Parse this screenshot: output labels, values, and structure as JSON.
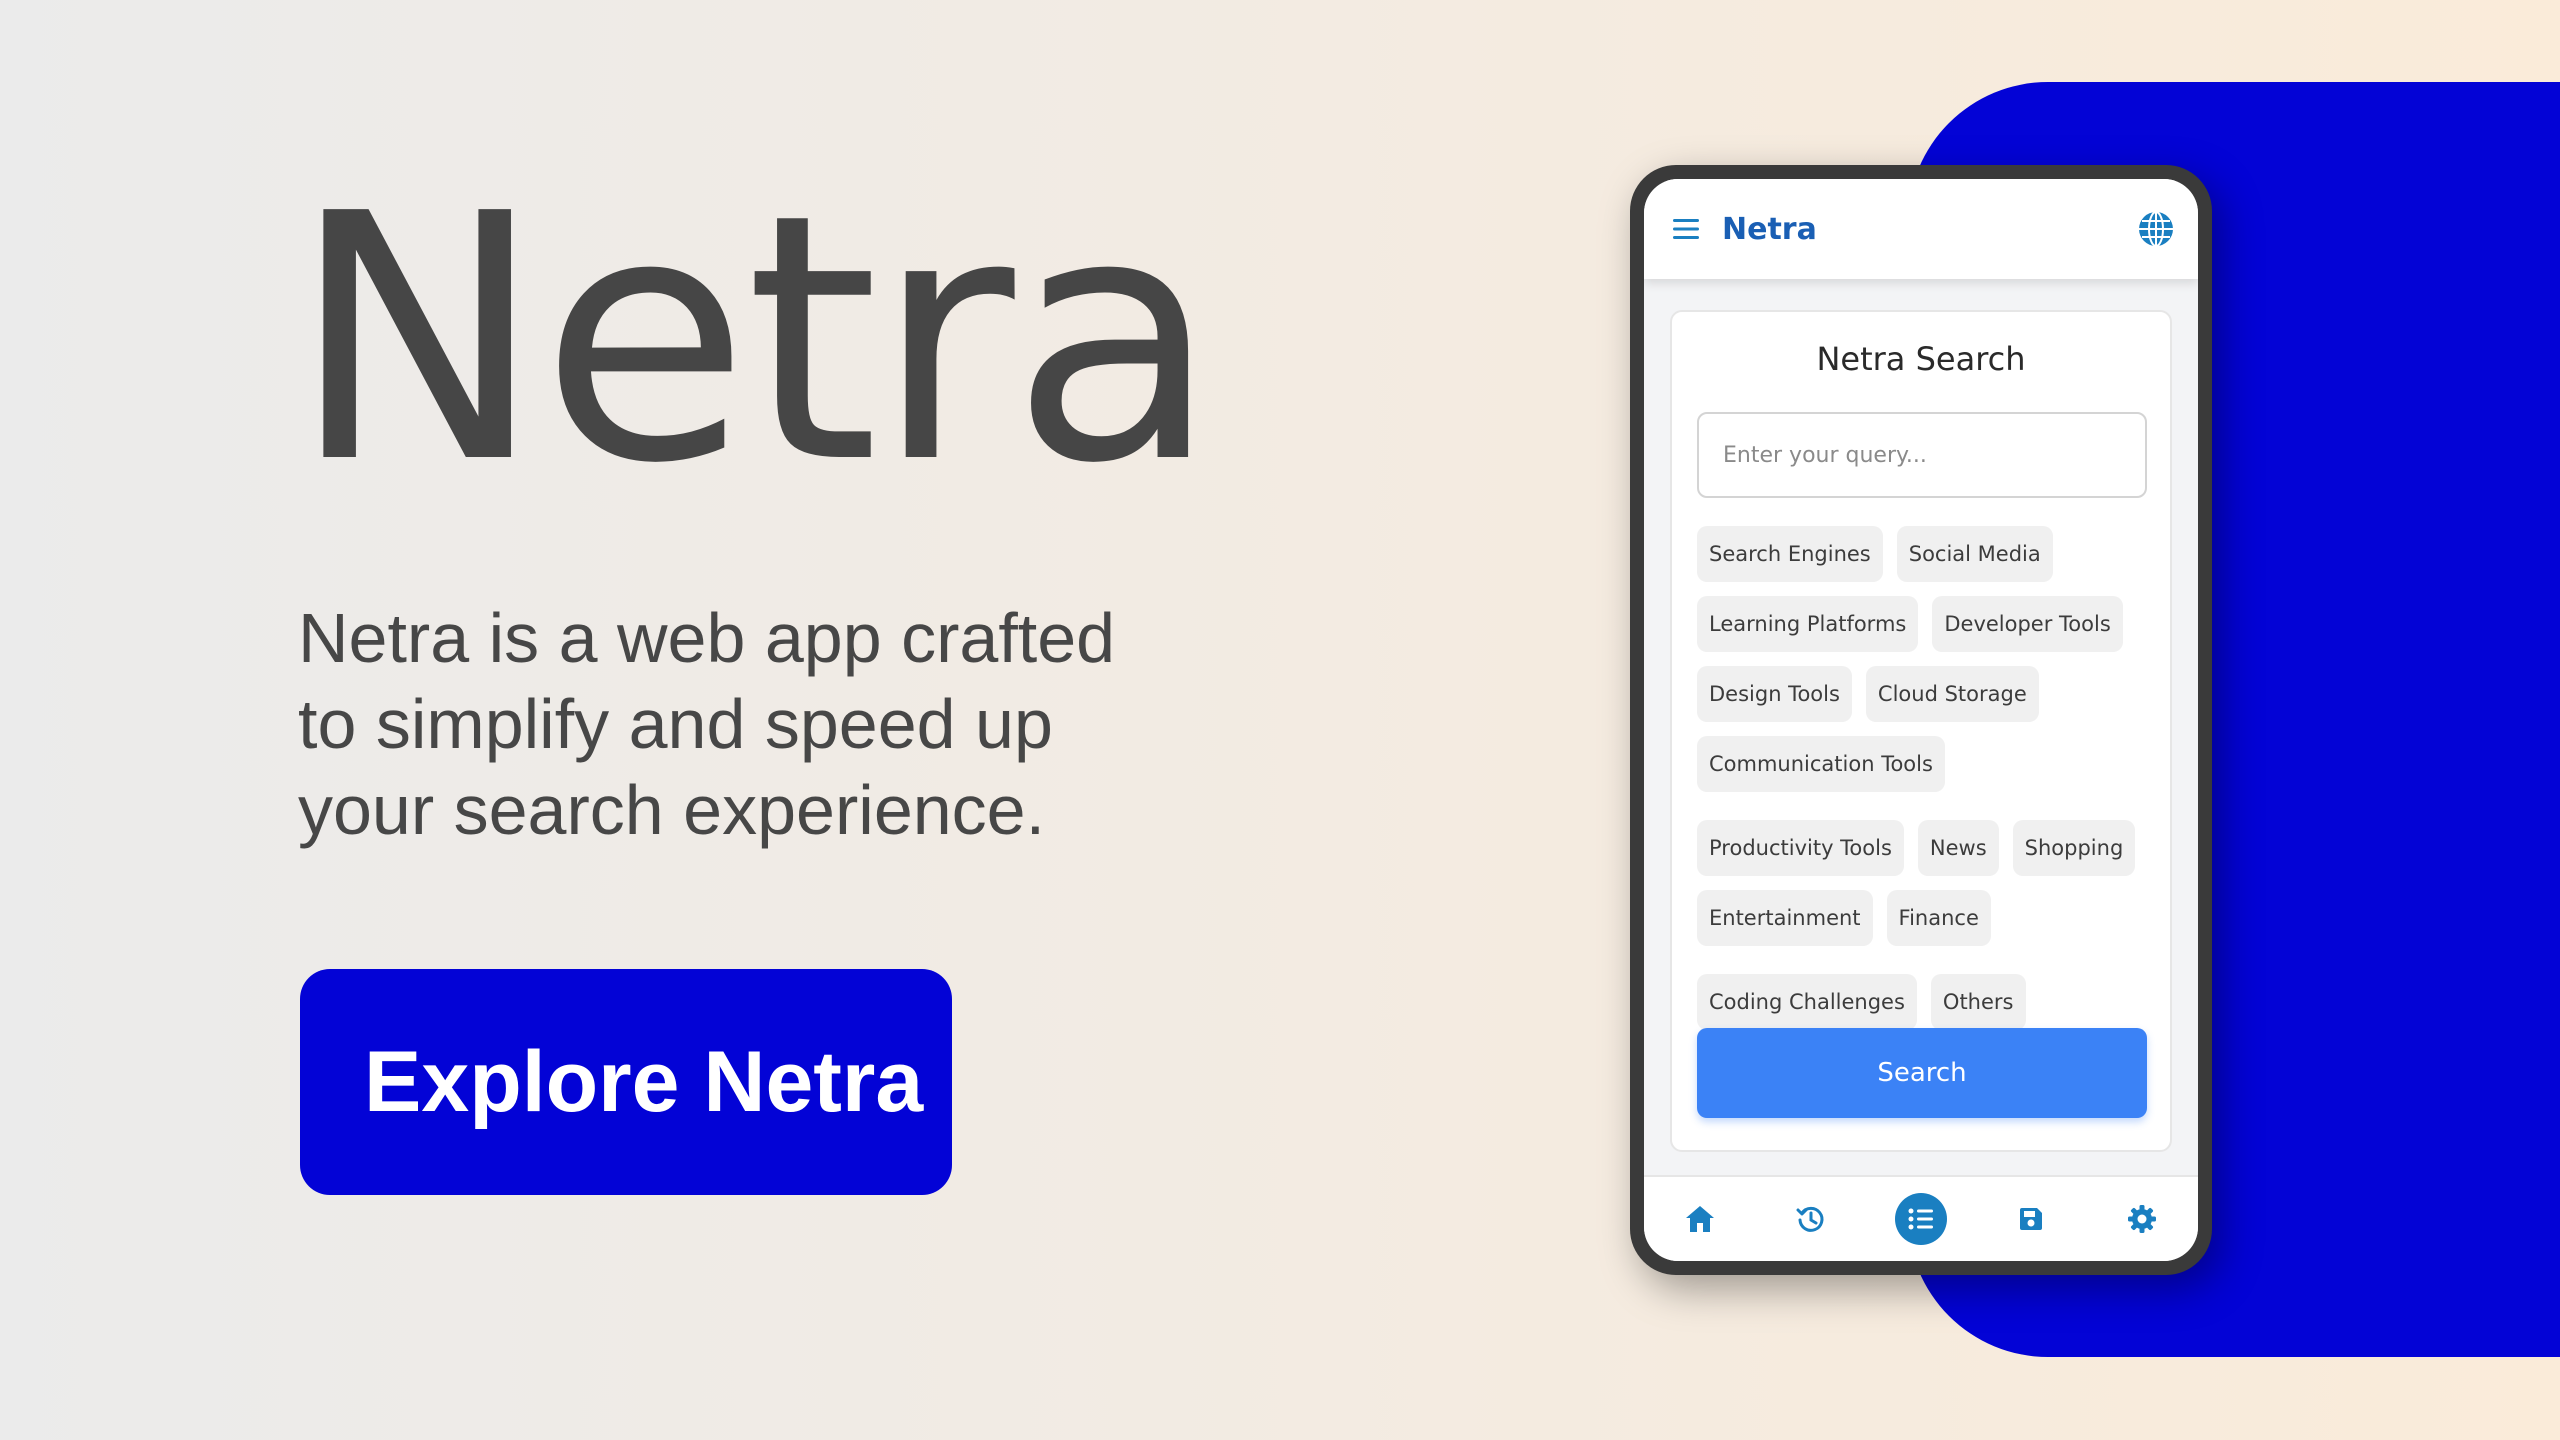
{
  "hero": {
    "title": "Netra",
    "description": "Netra is a web app crafted to simplify and speed up your search experience.",
    "cta_label": "Explore Netra"
  },
  "colors": {
    "accent_blue": "#0303d6",
    "app_brand": "#1a5fb4",
    "search_button": "#3b82f6",
    "nav_icon": "#1a7fc1"
  },
  "app": {
    "topbar": {
      "brand": "Netra",
      "menu_icon": "hamburger-menu-icon",
      "language_icon": "globe-icon"
    },
    "search_card": {
      "title": "Netra Search",
      "input_placeholder": "Enter your query...",
      "input_value": "",
      "categories": [
        "Search Engines",
        "Social Media",
        "Learning Platforms",
        "Developer Tools",
        "Design Tools",
        "Cloud Storage",
        "Communication Tools",
        "Productivity Tools",
        "News",
        "Shopping",
        "Entertainment",
        "Finance",
        "Coding Challenges",
        "Others"
      ],
      "search_label": "Search"
    },
    "bottom_nav": [
      {
        "icon": "home-icon",
        "active": false
      },
      {
        "icon": "history-icon",
        "active": false
      },
      {
        "icon": "list-icon",
        "active": true
      },
      {
        "icon": "save-icon",
        "active": false
      },
      {
        "icon": "settings-gear-icon",
        "active": false
      }
    ]
  }
}
